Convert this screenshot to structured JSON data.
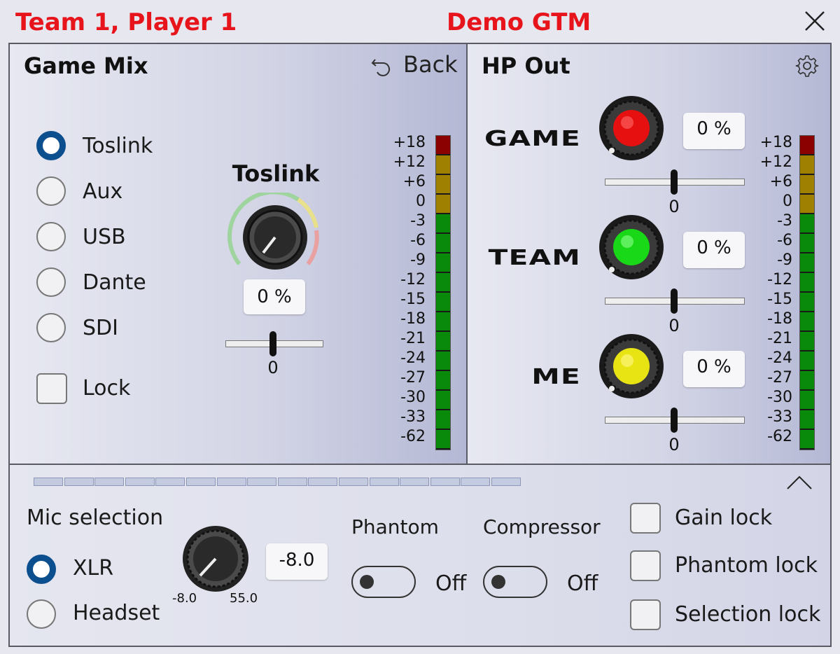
{
  "window": {
    "title_left": "Team 1, Player 1",
    "title_center": "Demo GTM",
    "close_icon": "close-icon"
  },
  "game_mix": {
    "title": "Game Mix",
    "back_label": "Back",
    "inputs": [
      {
        "label": "Toslink",
        "selected": true
      },
      {
        "label": "Aux",
        "selected": false
      },
      {
        "label": "USB",
        "selected": false
      },
      {
        "label": "Dante",
        "selected": false
      },
      {
        "label": "SDI",
        "selected": false
      }
    ],
    "lock_label": "Lock",
    "selected_name": "Toslink",
    "knob_value": "0 %",
    "slider_value": "0",
    "meter_scale": [
      "+18",
      "+12",
      "+6",
      "0",
      "-3",
      "-6",
      "-9",
      "-12",
      "-15",
      "-18",
      "-21",
      "-24",
      "-27",
      "-30",
      "-33",
      "-62"
    ]
  },
  "hp_out": {
    "title": "HP Out",
    "settings_icon": "gear-icon",
    "channels": [
      {
        "label": "GAME",
        "knob_color": "#e61010",
        "value": "0 %",
        "slider_value": "0"
      },
      {
        "label": "TEAM",
        "knob_color": "#18d818",
        "value": "0 %",
        "slider_value": "0"
      },
      {
        "label": "ME",
        "knob_color": "#e8e414",
        "value": "0 %",
        "slider_value": "0"
      }
    ],
    "meter_scale": [
      "+18",
      "+12",
      "+6",
      "0",
      "-3",
      "-6",
      "-9",
      "-12",
      "-15",
      "-18",
      "-21",
      "-24",
      "-27",
      "-30",
      "-33",
      "-62"
    ]
  },
  "mic": {
    "title": "Mic selection",
    "options": [
      {
        "label": "XLR",
        "selected": true
      },
      {
        "label": "Headset",
        "selected": false
      }
    ],
    "gain_value": "-8.0",
    "gain_min": "-8.0",
    "gain_max": "55.0",
    "phantom_label": "Phantom",
    "phantom_state": "Off",
    "compressor_label": "Compressor",
    "compressor_state": "Off",
    "locks": [
      "Gain lock",
      "Phantom lock",
      "Selection lock"
    ],
    "collapse_icon": "chevron-up-icon"
  },
  "colors": {
    "title_red": "#e8141c",
    "radio_blue": "#0c4f8f",
    "meter_red": "#8b0000",
    "meter_yellow": "#a08000",
    "meter_green": "#0a8a0a"
  }
}
